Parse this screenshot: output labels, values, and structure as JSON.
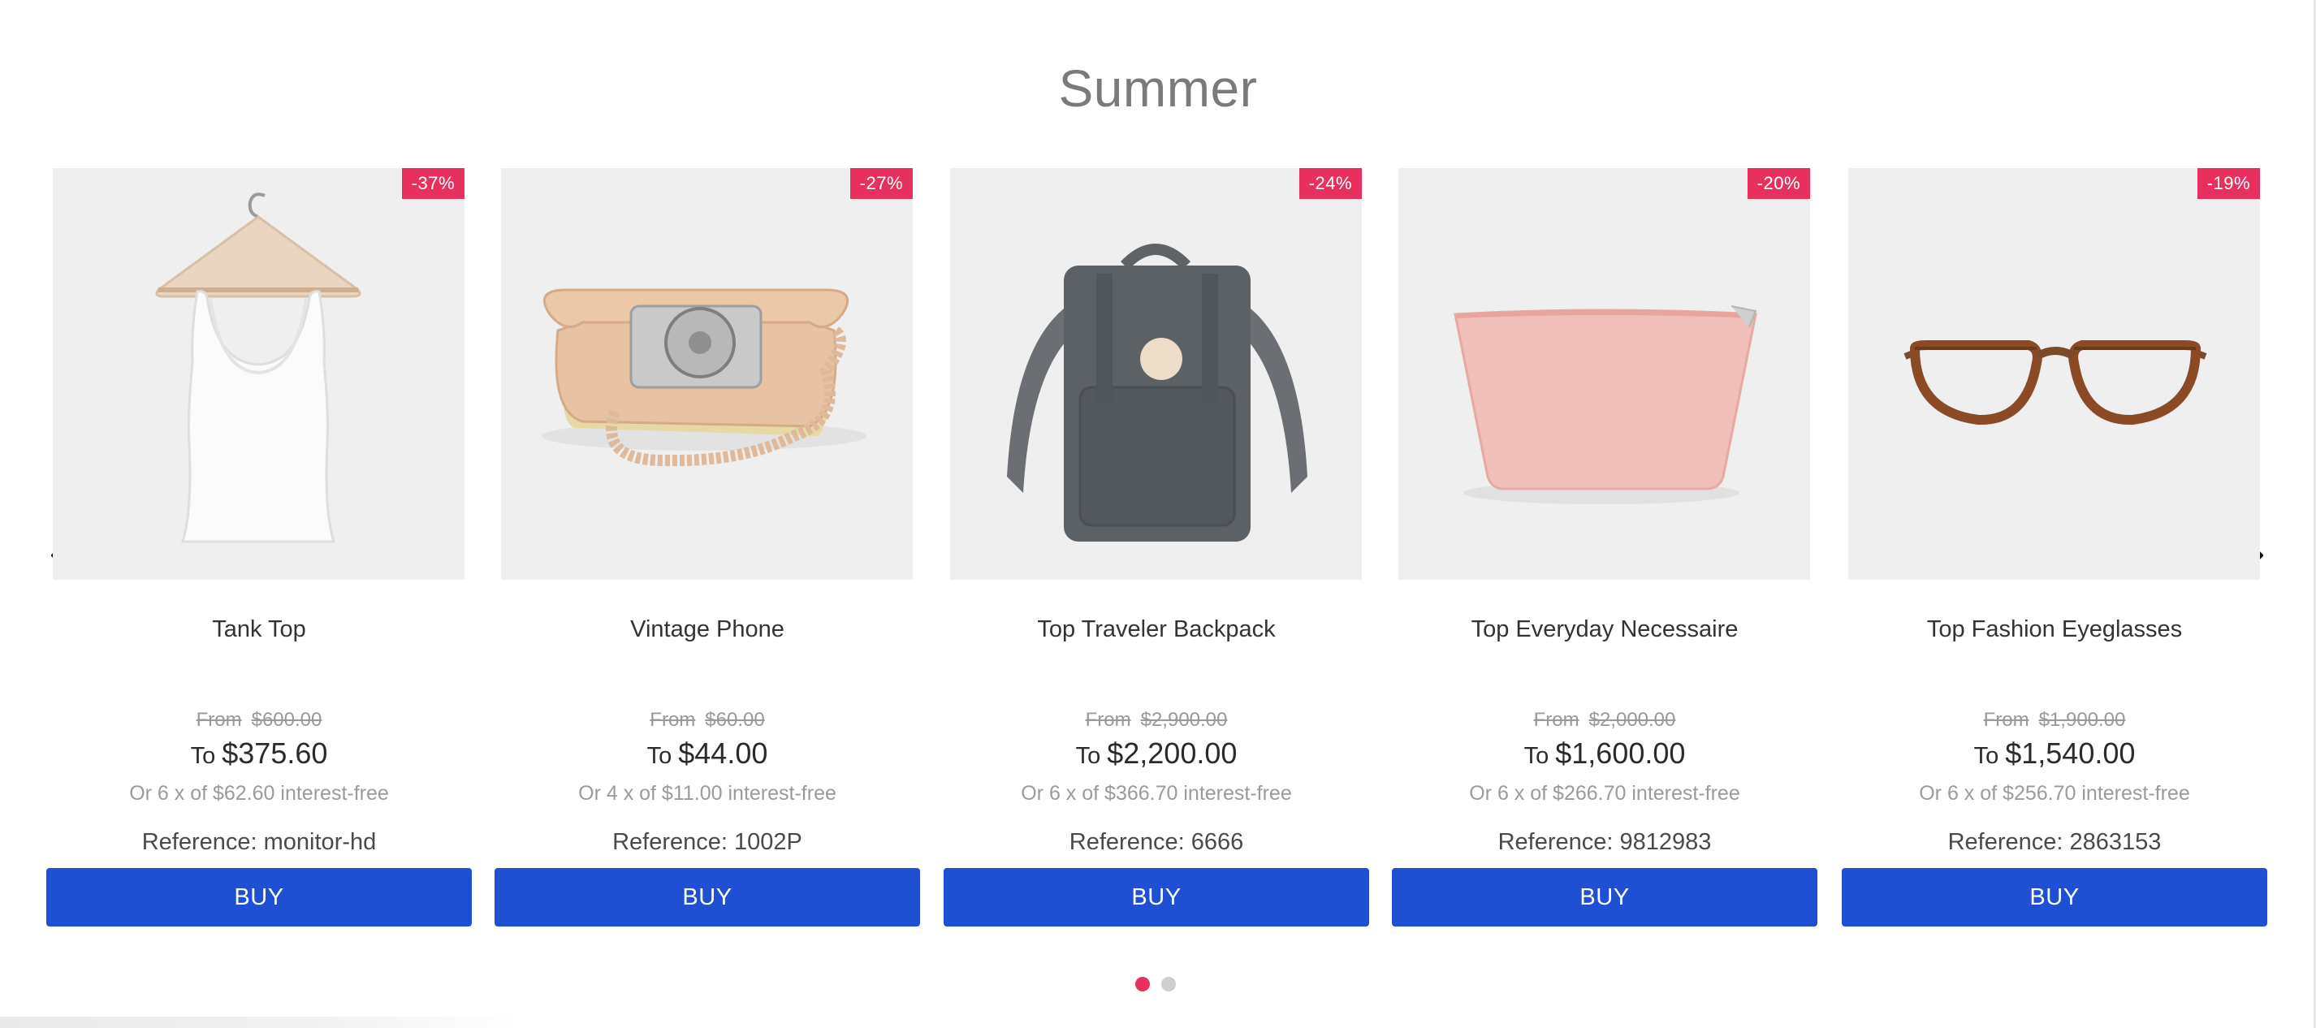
{
  "section": {
    "title": "Summer"
  },
  "carousel": {
    "prev_icon": "chevron-left-icon",
    "next_icon": "chevron-right-icon",
    "dots": [
      {
        "active": true
      },
      {
        "active": false
      }
    ],
    "colors": {
      "dot_active": "#e8305f",
      "dot_inactive": "#cfcfcf"
    }
  },
  "colors": {
    "badge": "#e8305f",
    "buy_button": "#1f4fd3"
  },
  "products": [
    {
      "name": "Tank Top",
      "discount": "-37%",
      "from_label": "From",
      "old_price": "$600.00",
      "to_label": "To",
      "price": "$375.60",
      "installment": "Or 6 x of $62.60 interest-free",
      "reference": "Reference: monitor-hd",
      "buy_label": "BUY",
      "image": "tank-top-on-hanger"
    },
    {
      "name": "Vintage Phone",
      "discount": "-27%",
      "from_label": "From",
      "old_price": "$60.00",
      "to_label": "To",
      "price": "$44.00",
      "installment": "Or 4 x of $11.00 interest-free",
      "reference": "Reference: 1002P",
      "buy_label": "BUY",
      "image": "rotary-phone"
    },
    {
      "name": "Top Traveler Backpack",
      "discount": "-24%",
      "from_label": "From",
      "old_price": "$2,900.00",
      "to_label": "To",
      "price": "$2,200.00",
      "installment": "Or 6 x of $366.70 interest-free",
      "reference": "Reference: 6666",
      "buy_label": "BUY",
      "image": "grey-backpack"
    },
    {
      "name": "Top Everyday Necessaire",
      "discount": "-20%",
      "from_label": "From",
      "old_price": "$2,000.00",
      "to_label": "To",
      "price": "$1,600.00",
      "installment": "Or 6 x of $266.70 interest-free",
      "reference": "Reference: 9812983",
      "buy_label": "BUY",
      "image": "pink-pouch"
    },
    {
      "name": "Top Fashion Eyeglasses",
      "discount": "-19%",
      "from_label": "From",
      "old_price": "$1,900.00",
      "to_label": "To",
      "price": "$1,540.00",
      "installment": "Or 6 x of $256.70 interest-free",
      "reference": "Reference: 2863153",
      "buy_label": "BUY",
      "image": "tortoise-eyeglasses"
    }
  ]
}
